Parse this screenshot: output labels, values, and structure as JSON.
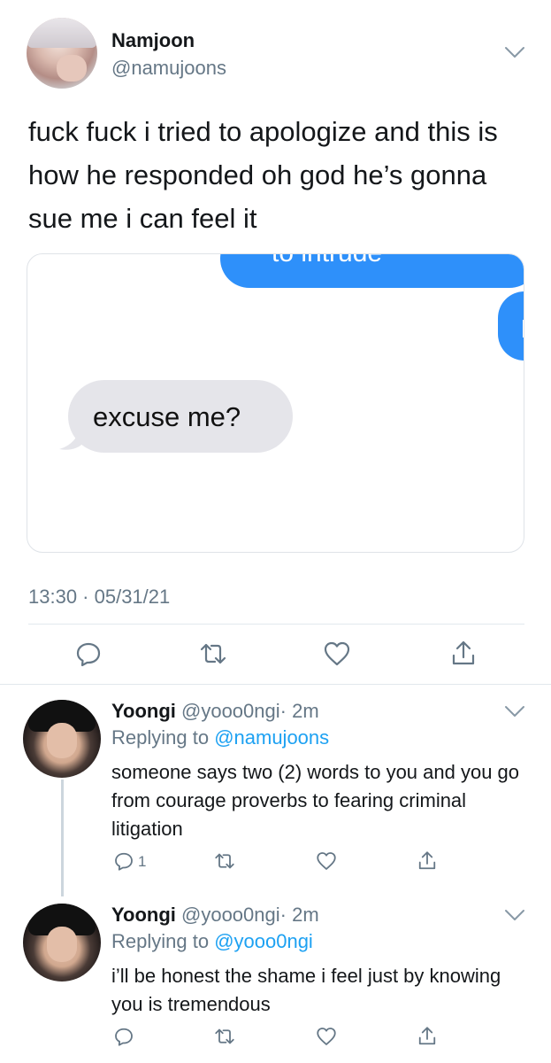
{
  "main_tweet": {
    "name": "Namjoon",
    "handle": "@namujoons",
    "text": "fuck fuck i tried to apologize and this is how he responded oh god he’s gonna sue me i can feel it",
    "media": {
      "sent_bubble_text": "to intrude",
      "received_bubble_text": "excuse me?"
    },
    "timestamp": "13:30 · 05/31/21"
  },
  "replies": [
    {
      "name": "Yoongi",
      "handle": "@yooo0ngi",
      "time": "· 2m",
      "replying_label": "Replying to ",
      "replying_to": "@namujoons",
      "text": "someone says two (2) words to you and you go from courage proverbs to fearing criminal litigation",
      "reply_count": "1"
    },
    {
      "name": "Yoongi",
      "handle": "@yooo0ngi",
      "time": "· 2m",
      "replying_label": "Replying to ",
      "replying_to": "@yooo0ngi",
      "text": "i’ll be honest the shame i feel just by knowing you is tremendous",
      "reply_count": ""
    }
  ],
  "icons": [
    "chevron-down-icon",
    "reply-icon",
    "retweet-icon",
    "like-icon",
    "share-icon"
  ],
  "colors": {
    "text": "#14171a",
    "secondary": "#657786",
    "link": "#1da1f2",
    "imessage_blue": "#2e90fa",
    "imessage_gray": "#e5e5ea",
    "divider": "#e1e8ed"
  }
}
